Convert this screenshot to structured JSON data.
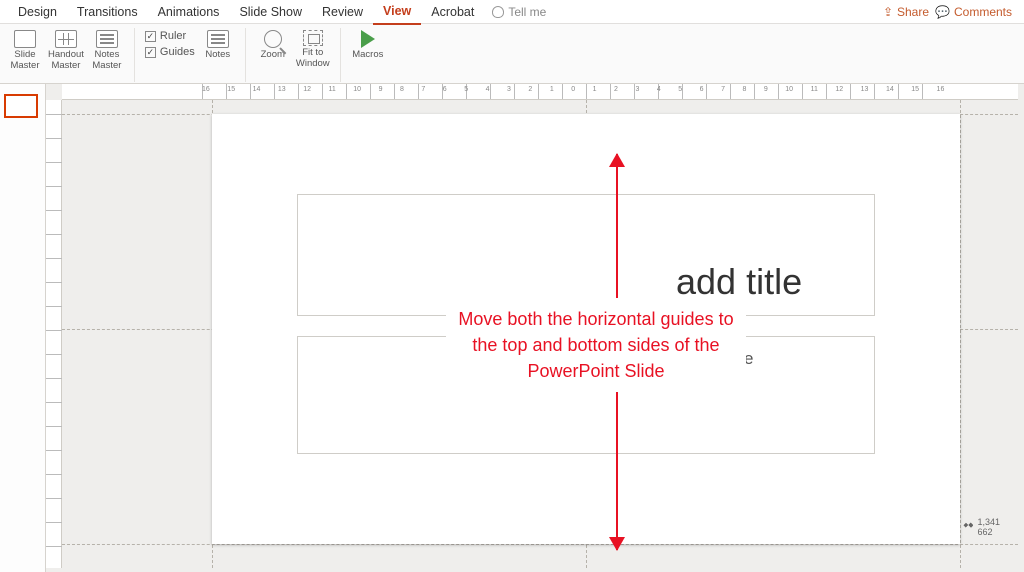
{
  "menu": {
    "items": [
      "Design",
      "Transitions",
      "Animations",
      "Slide Show",
      "Review",
      "View",
      "Acrobat"
    ],
    "active_index": 5,
    "tell_me": "Tell me",
    "share": "Share",
    "comments": "Comments"
  },
  "ribbon": {
    "masters": {
      "slide": "Slide\nMaster",
      "handout": "Handout\nMaster",
      "notes": "Notes\nMaster"
    },
    "show": {
      "ruler": "Ruler",
      "guides": "Guides",
      "ruler_checked": true,
      "guides_checked": true,
      "notes_btn": "Notes"
    },
    "zoom": {
      "zoom": "Zoom",
      "fit": "Fit to\nWindow"
    },
    "macros": "Macros"
  },
  "ruler": {
    "numbers": [
      "16",
      "15",
      "14",
      "13",
      "12",
      "11",
      "10",
      "9",
      "8",
      "7",
      "6",
      "5",
      "4",
      "3",
      "2",
      "1",
      "0",
      "1",
      "2",
      "3",
      "4",
      "5",
      "6",
      "7",
      "8",
      "9",
      "10",
      "11",
      "12",
      "13",
      "14",
      "15",
      "16"
    ]
  },
  "slide": {
    "title_placeholder": "add title",
    "subtitle_placeholder": "dd subtitle"
  },
  "annotation": "Move both the horizontal guides to the top and bottom sides of the PowerPoint Slide",
  "status": {
    "cursor": "1,341\n662"
  },
  "colors": {
    "accent": "#d83b01",
    "annot": "#e81123"
  }
}
